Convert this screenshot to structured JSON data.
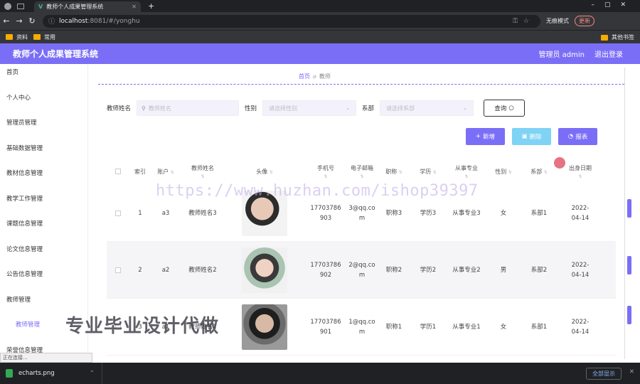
{
  "browser": {
    "tab_title": "教师个人成果管理系统",
    "url_host": "localhost",
    "url_path": ":8081/#/yonghu",
    "incognito_label": "无痕模式",
    "update_label": "更新",
    "bookmarks": [
      "资料",
      "常用"
    ],
    "bookmarks_right": "其他书签",
    "status_text": "正在连接...",
    "download_file": "echarts.png",
    "show_all": "全部显示"
  },
  "header": {
    "title": "教师个人成果管理系统",
    "user": "管理员 admin",
    "logout": "退出登录"
  },
  "sidebar": {
    "items": [
      {
        "label": "首页"
      },
      {
        "label": "个人中心"
      },
      {
        "label": "管理员管理"
      },
      {
        "label": "基础数据管理"
      },
      {
        "label": "教材信息管理"
      },
      {
        "label": "教学工作管理"
      },
      {
        "label": "课题信息管理"
      },
      {
        "label": "论文信息管理"
      },
      {
        "label": "公告信息管理"
      },
      {
        "label": "教师管理"
      },
      {
        "label": "教师管理"
      },
      {
        "label": "荣誉信息管理"
      }
    ]
  },
  "breadcrumb": {
    "home": "首页",
    "current": "教师"
  },
  "filters": {
    "name_label": "教师姓名",
    "name_placeholder": "教师姓名",
    "gender_label": "性别",
    "gender_placeholder": "请选择性别",
    "dept_label": "系部",
    "dept_placeholder": "请选择系部",
    "query_label": "查询"
  },
  "actions": {
    "add": "新增",
    "delete": "删除",
    "report": "报表"
  },
  "table": {
    "headers": [
      "索引",
      "账户",
      "教师姓名",
      "头像",
      "手机号",
      "电子邮箱",
      "职称",
      "学历",
      "从事专业",
      "性别",
      "系部",
      "出身日期"
    ],
    "rows": [
      {
        "index": "1",
        "account": "a3",
        "name": "教师姓名3",
        "phone": "17703786903",
        "email": "3@qq.com",
        "title": "职称3",
        "edu": "学历3",
        "major": "从事专业3",
        "gender": "女",
        "dept": "系部1",
        "birth": "2022-04-14"
      },
      {
        "index": "2",
        "account": "a2",
        "name": "教师姓名2",
        "phone": "17703786902",
        "email": "2@qq.com",
        "title": "职称2",
        "edu": "学历2",
        "major": "从事专业2",
        "gender": "男",
        "dept": "系部2",
        "birth": "2022-04-14"
      },
      {
        "index": "3",
        "account": "a1",
        "name": "教师姓名1",
        "phone": "17703786901",
        "email": "1@qq.com",
        "title": "职称1",
        "edu": "学历1",
        "major": "从事专业1",
        "gender": "女",
        "dept": "系部1",
        "birth": "2022-04-14"
      }
    ]
  },
  "watermarks": {
    "url": "https://www.huzhan.com/ishop39397",
    "text": "专业毕业设计代做"
  },
  "colors": {
    "accent": "#7b6ef6",
    "light_blue": "#7fd3f5"
  }
}
